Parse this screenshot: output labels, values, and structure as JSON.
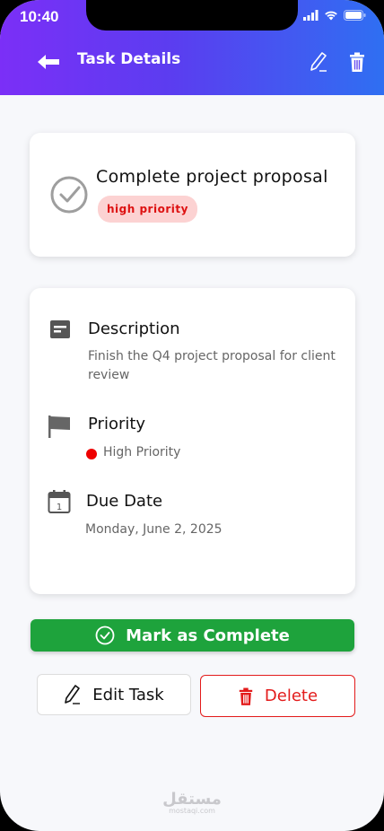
{
  "status_bar": {
    "time": "10:40"
  },
  "header": {
    "title": "Task Details",
    "back_icon": "back-arrow-icon",
    "edit_icon": "pencil-icon",
    "delete_icon": "trash-icon"
  },
  "task": {
    "title": "Complete project proposal",
    "priority_badge": "high  priority"
  },
  "details": {
    "description": {
      "label": "Description",
      "text": "Finish the Q4 project proposal for client review"
    },
    "priority": {
      "label": "Priority",
      "value": "High Priority"
    },
    "due_date": {
      "label": "Due Date",
      "value": "Monday, June 2, 2025"
    }
  },
  "actions": {
    "complete": "Mark as Complete",
    "edit": "Edit Task",
    "delete": "Delete"
  },
  "watermark": {
    "text": "مستقل",
    "sub": "mostaqi.com"
  },
  "colors": {
    "header_start": "#7b2ff7",
    "header_end": "#2f6ff2",
    "complete": "#1ea33c",
    "danger": "#e31b1b",
    "priority_bg": "#fcd2d2"
  }
}
